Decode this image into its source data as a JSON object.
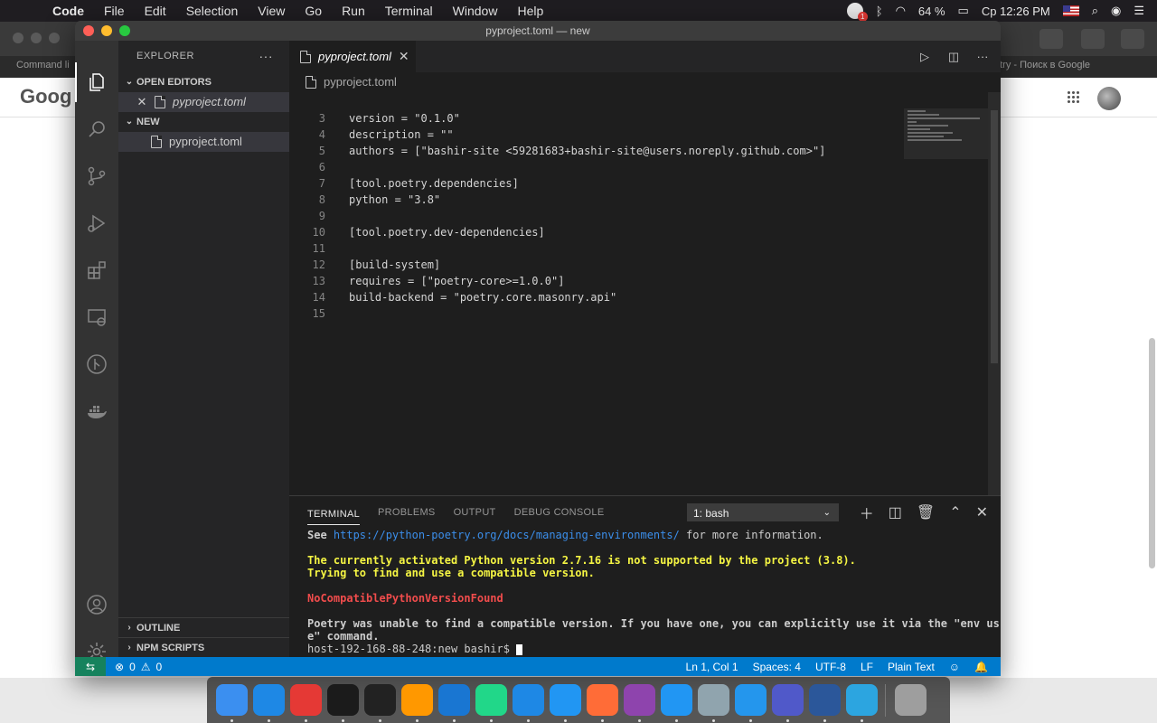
{
  "menubar": {
    "app": "Code",
    "items": [
      "File",
      "Edit",
      "Selection",
      "View",
      "Go",
      "Run",
      "Terminal",
      "Window",
      "Help"
    ],
    "battery": "64 %",
    "clock": "Ср 12:26 PM",
    "notification_count": "1"
  },
  "browser": {
    "left_tab": "Command li",
    "right_tab": "etry - Поиск в Google",
    "logo_text": "Goog"
  },
  "window": {
    "title": "pyproject.toml — new"
  },
  "explorer": {
    "header": "EXPLORER",
    "more": "···",
    "open_editors_label": "OPEN EDITORS",
    "open_editor_file": "pyproject.toml",
    "folder_label": "NEW",
    "folder_file": "pyproject.toml",
    "outline_label": "OUTLINE",
    "npm_label": "NPM SCRIPTS"
  },
  "editor": {
    "tab_label": "pyproject.toml",
    "breadcrumb": "pyproject.toml",
    "lines": [
      {
        "n": "3",
        "text": "version = \"0.1.0\""
      },
      {
        "n": "4",
        "text": "description = \"\""
      },
      {
        "n": "5",
        "text": "authors = [\"bashir-site <59281683+bashir-site@users.noreply.github.com>\"]"
      },
      {
        "n": "6",
        "text": ""
      },
      {
        "n": "7",
        "text": "[tool.poetry.dependencies]"
      },
      {
        "n": "8",
        "text": "python = \"3.8\""
      },
      {
        "n": "9",
        "text": ""
      },
      {
        "n": "10",
        "text": "[tool.poetry.dev-dependencies]"
      },
      {
        "n": "11",
        "text": ""
      },
      {
        "n": "12",
        "text": "[build-system]"
      },
      {
        "n": "13",
        "text": "requires = [\"poetry-core>=1.0.0\"]"
      },
      {
        "n": "14",
        "text": "build-backend = \"poetry.core.masonry.api\""
      },
      {
        "n": "15",
        "text": ""
      }
    ]
  },
  "panel": {
    "tabs": [
      "TERMINAL",
      "PROBLEMS",
      "OUTPUT",
      "DEBUG CONSOLE"
    ],
    "terminal_select": "1: bash",
    "see_prefix": "See ",
    "see_link": "https://python-poetry.org/docs/managing-environments/",
    "see_suffix": " for more information.",
    "warn1": "The currently activated Python version 2.7.16 is not supported by the project (3.8).",
    "warn2": "Trying to find and use a compatible version.",
    "error": "NoCompatiblePythonVersionFound",
    "msg1": "Poetry was unable to find a compatible version. If you have one, you can explicitly use it via the \"env us",
    "msg2": "e\" command.",
    "prompt": "host-192-168-88-248:new bashir$ "
  },
  "statusbar": {
    "errors": "0",
    "warnings": "0",
    "position": "Ln 1, Col 1",
    "spaces": "Spaces: 4",
    "encoding": "UTF-8",
    "eol": "LF",
    "language": "Plain Text"
  },
  "dock": {
    "apps": [
      {
        "name": "finder",
        "color": "#3b8ff0"
      },
      {
        "name": "safari",
        "color": "#1e88e5"
      },
      {
        "name": "chrome",
        "color": "#e53935"
      },
      {
        "name": "activity-monitor",
        "color": "#1b1b1b"
      },
      {
        "name": "terminal",
        "color": "#222222"
      },
      {
        "name": "sublime",
        "color": "#ff9800"
      },
      {
        "name": "vscode",
        "color": "#1976d2"
      },
      {
        "name": "pycharm",
        "color": "#21d789"
      },
      {
        "name": "xcode-instruments",
        "color": "#1e88e5"
      },
      {
        "name": "app-store",
        "color": "#2196f3"
      },
      {
        "name": "postman",
        "color": "#ff6c37"
      },
      {
        "name": "github",
        "color": "#8e44ad"
      },
      {
        "name": "sequel",
        "color": "#2196f3"
      },
      {
        "name": "postgres",
        "color": "#90a4ae"
      },
      {
        "name": "docker",
        "color": "#2496ed"
      },
      {
        "name": "teams",
        "color": "#5059c9"
      },
      {
        "name": "word",
        "color": "#2b579a"
      },
      {
        "name": "telegram",
        "color": "#2ca5e0"
      }
    ]
  }
}
